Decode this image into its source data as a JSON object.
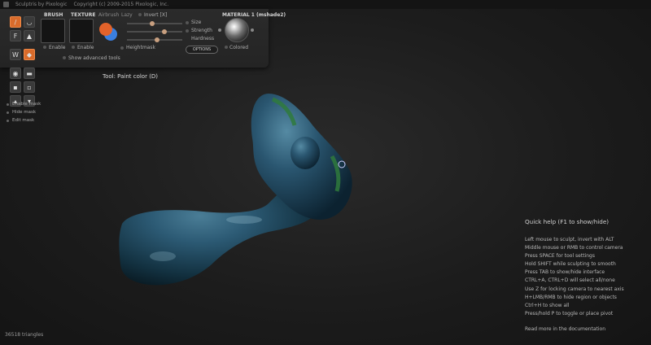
{
  "window": {
    "title": "Sculptris by Pixologic",
    "copyright": "Copyright (c) 2009-2015 Pixologic, Inc."
  },
  "toolbar": {
    "brush_label": "BRUSH",
    "texture_label": "TEXTURE",
    "airbrush_label": "Airbrush",
    "lazy_label": "Lazy",
    "invert_label": "Invert [X]",
    "size_label": "Size",
    "strength_label": "Strength",
    "hardness_label": "Hardness",
    "material_label": "MATERIAL 1 (mshade2)",
    "enable_brush_label": "Enable",
    "enable_texture_label": "Enable",
    "heightmask_label": "Heightmask",
    "options_label": "OPTIONS",
    "colored_label": "Colored",
    "show_advanced_label": "Show advanced tools",
    "primary_color": "#e2622a",
    "secondary_color": "#3a7fe0",
    "size_value": 0.45,
    "strength_value": 0.7,
    "hardness_value": 0.55
  },
  "tool_status": "Tool: Paint color (D)",
  "mask_menu": [
    "Enable mask",
    "Hide mask",
    "Edit mask"
  ],
  "quick_help": {
    "title": "Quick help (F1 to show/hide)",
    "lines": [
      "Left mouse to sculpt, invert with ALT",
      "Middle mouse or RMB to control camera",
      "Press SPACE for tool settings",
      "Hold SHIFT while sculpting to smooth",
      "Press TAB to show/hide interface",
      "CTRL+A, CTRL+D will select all/none",
      "Use Z for locking camera to nearest axis",
      "H+LMB/RMB to hide region or objects",
      "Ctrl+H to show all",
      "Press/hold P to toggle or place pivot"
    ],
    "more": "Read more in the documentation"
  },
  "status": {
    "triangles": "36518 triangles"
  },
  "icons": [
    "app-icon",
    "paint-brush-icon",
    "crease-icon",
    "flatten-icon",
    "inflate-icon",
    "pinch-icon",
    "grab-icon",
    "smooth-icon",
    "reduce-icon",
    "mask-icon",
    "color-icon"
  ]
}
